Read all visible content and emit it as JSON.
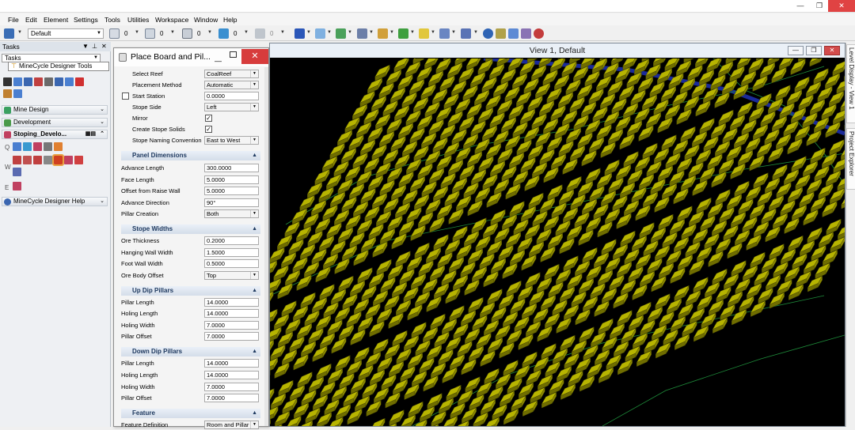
{
  "menu": [
    "File",
    "Edit",
    "Element",
    "Settings",
    "Tools",
    "Utilities",
    "Workspace",
    "Window",
    "Help"
  ],
  "toolbar": {
    "level_combo": "Default",
    "values": [
      "0",
      "0",
      "0",
      "0",
      "0"
    ]
  },
  "tasks": {
    "title": "Tasks",
    "combo": "Tasks",
    "popup_item": "MineCycle Designer Tools",
    "sections": {
      "mine_design": "Mine Design",
      "development": "Development",
      "stoping": "Stoping_Develo...",
      "help": "MineCycle Designer Help"
    },
    "side_letters": [
      "Q",
      "W",
      "E"
    ]
  },
  "dialog": {
    "title": "Place Board and Pil...",
    "close": "✕",
    "general": {
      "select_reef_label": "Select Reef",
      "select_reef": "CoalReef",
      "placement_method_label": "Placement Method",
      "placement_method": "Automatic",
      "start_station_label": "Start Station",
      "start_station": "0.0000",
      "stope_side_label": "Stope Side",
      "stope_side": "Left",
      "mirror_label": "Mirror",
      "create_stope_solids_label": "Create Stope Solids",
      "stope_naming_label": "Stope Naming Convention",
      "stope_naming": "East to West"
    },
    "panel_dimensions": {
      "header": "Panel Dimensions",
      "advance_length_label": "Advance Length",
      "advance_length": "300.0000",
      "face_length_label": "Face Length",
      "face_length": "5.0000",
      "offset_raise_wall_label": "Offset from Raise Wall",
      "offset_raise_wall": "5.0000",
      "advance_direction_label": "Advance Direction",
      "advance_direction": "90°",
      "pillar_creation_label": "Pillar Creation",
      "pillar_creation": "Both"
    },
    "stope_widths": {
      "header": "Stope Widths",
      "ore_thickness_label": "Ore Thickness",
      "ore_thickness": "0.2000",
      "hanging_wall_label": "Hanging Wall Width",
      "hanging_wall": "1.5000",
      "foot_wall_label": "Foot Wall Width",
      "foot_wall": "0.5000",
      "ore_body_offset_label": "Ore Body Offset",
      "ore_body_offset": "Top"
    },
    "up_dip": {
      "header": "Up Dip Pillars",
      "pillar_length_label": "Pillar Length",
      "pillar_length": "14.0000",
      "holing_length_label": "Holing Length",
      "holing_length": "14.0000",
      "holing_width_label": "Holing Width",
      "holing_width": "7.0000",
      "pillar_offset_label": "Pillar Offset",
      "pillar_offset": "7.0000"
    },
    "down_dip": {
      "header": "Down Dip Pillars",
      "pillar_length_label": "Pillar Length",
      "pillar_length": "14.0000",
      "holing_length_label": "Holing Length",
      "holing_length": "14.0000",
      "holing_width_label": "Holing Width",
      "holing_width": "7.0000",
      "pillar_offset_label": "Pillar Offset",
      "pillar_offset": "7.0000"
    },
    "feature": {
      "header": "Feature",
      "definition_label": "Feature Definition",
      "definition": "Room and Pillar"
    }
  },
  "view": {
    "title": "View 1, Default"
  },
  "right_dock": {
    "tab1": "Level Display - View 1",
    "tab2": "Project Explorer"
  },
  "colors": {
    "pillar_fill": "#b7b400",
    "pillar_edge": "#4a4a00",
    "contour": "#1e8c3a",
    "reef_edge": "#1a2a9a"
  }
}
